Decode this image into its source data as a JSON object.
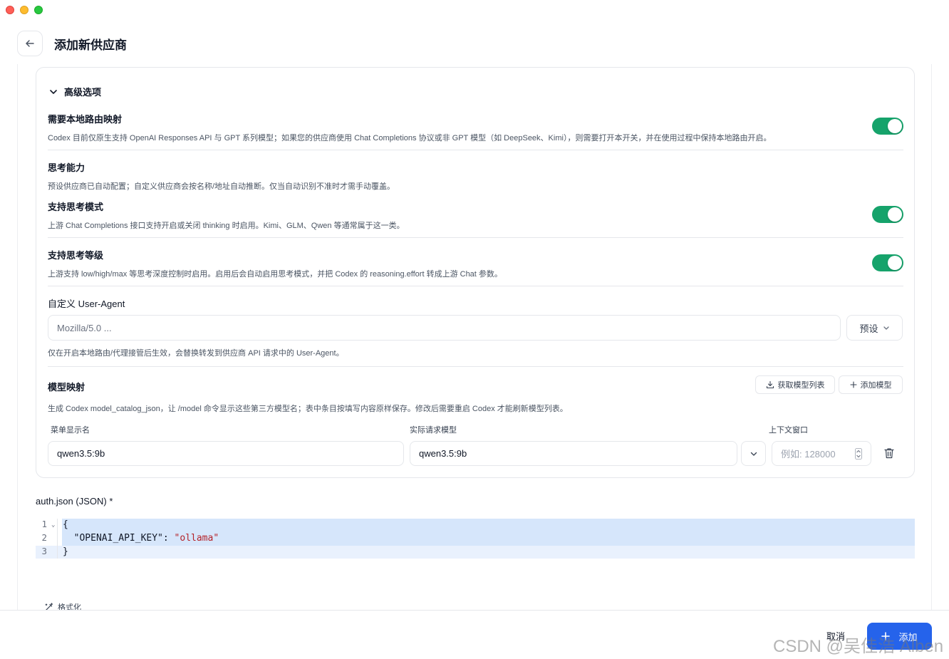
{
  "header": {
    "title": "添加新供应商"
  },
  "advanced": {
    "heading": "高级选项",
    "local_routing": {
      "title": "需要本地路由映射",
      "desc": "Codex 目前仅原生支持 OpenAI Responses API 与 GPT 系列模型；如果您的供应商使用 Chat Completions 协议或非 GPT 模型（如 DeepSeek、Kimi），则需要打开本开关，并在使用过程中保持本地路由开启。",
      "enabled": true
    },
    "thinking": {
      "title": "思考能力",
      "desc": "预设供应商已自动配置；自定义供应商会按名称/地址自动推断。仅当自动识别不准时才需手动覆盖。"
    },
    "thinking_mode": {
      "title": "支持思考模式",
      "desc": "上游 Chat Completions 接口支持开启或关闭 thinking 时启用。Kimi、GLM、Qwen 等通常属于这一类。",
      "enabled": true
    },
    "thinking_level": {
      "title": "支持思考等级",
      "desc": "上游支持 low/high/max 等思考深度控制时启用。启用后会自动启用思考模式，并把 Codex 的 reasoning.effort 转成上游 Chat 参数。",
      "enabled": true
    },
    "user_agent": {
      "title": "自定义 User-Agent",
      "value": "Mozilla/5.0 ...",
      "preset_label": "预设",
      "desc": "仅在开启本地路由/代理接管后生效，会替换转发到供应商 API 请求中的 User-Agent。"
    },
    "model_mapping": {
      "title": "模型映射",
      "fetch_label": "获取模型列表",
      "add_label": "添加模型",
      "desc": "生成 Codex model_catalog_json，让 /model 命令显示这些第三方模型名；表中条目按填写内容原样保存。修改后需要重启 Codex 才能刷新模型列表。",
      "col_display": "菜单显示名",
      "col_actual": "实际请求模型",
      "col_context": "上下文窗口",
      "row": {
        "display": "qwen3.5:9b",
        "actual": "qwen3.5:9b",
        "context_placeholder": "例如: 128000"
      }
    }
  },
  "auth": {
    "label": "auth.json (JSON) *",
    "line_numbers": [
      "1",
      "2",
      "3"
    ],
    "line1": "{",
    "line2_key": "  \"OPENAI_API_KEY\": ",
    "line2_val": "\"ollama\"",
    "line3": "}",
    "format_label": "格式化"
  },
  "footer": {
    "cancel_label": "取消",
    "add_label": "添加",
    "watermark": "CSDN @吴佳浩 Alben"
  },
  "colors": {
    "toggle_on": "#16a36b",
    "primary": "#2563eb"
  }
}
